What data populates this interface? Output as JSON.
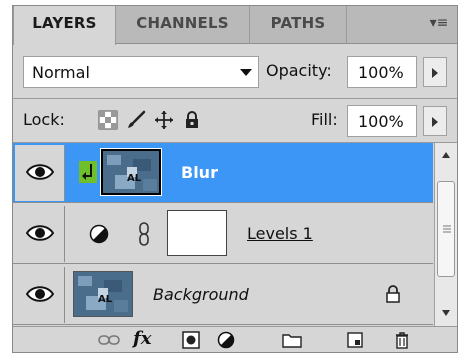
{
  "tabs": [
    {
      "label": "LAYERS"
    },
    {
      "label": "CHANNELS"
    },
    {
      "label": "PATHS"
    }
  ],
  "tab_menu_glyph": "▾≡",
  "blend_mode": "Normal",
  "opacity": {
    "label": "Opacity:",
    "value": "100%"
  },
  "lock": {
    "label": "Lock:"
  },
  "fill": {
    "label": "Fill:",
    "value": "100%"
  },
  "layers": [
    {
      "name": "Blur",
      "selected": true,
      "visible": true,
      "clipped": true
    },
    {
      "name": "Levels 1",
      "selected": false,
      "visible": true,
      "adjustment": "levels"
    },
    {
      "name": "Background",
      "selected": false,
      "visible": true,
      "locked": true
    }
  ],
  "footer_icons": [
    "link-icon",
    "fx-icon",
    "mask-icon",
    "adjustment-icon",
    "folder-icon",
    "new-layer-icon",
    "trash-icon"
  ],
  "footer_fx_label": "fx",
  "colors": {
    "selection": "#3c96f5",
    "panel": "#d6d6d6",
    "tabbar": "#b9b9b9"
  }
}
